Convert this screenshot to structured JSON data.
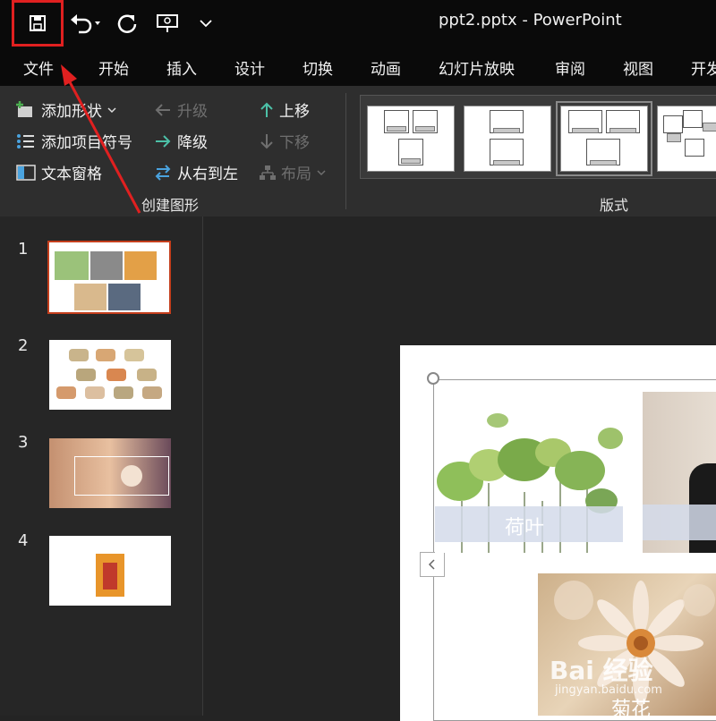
{
  "window": {
    "title": "ppt2.pptx  -  PowerPoint"
  },
  "quick_access": {
    "save": "save",
    "undo": "undo",
    "redo": "redo",
    "present": "present",
    "customize": "customize"
  },
  "tabs": [
    "文件",
    "开始",
    "插入",
    "设计",
    "切换",
    "动画",
    "幻灯片放映",
    "审阅",
    "视图",
    "开发"
  ],
  "ribbon": {
    "add_shape": "添加形状",
    "add_bullet": "添加项目符号",
    "text_pane": "文本窗格",
    "promote": "升级",
    "demote": "降级",
    "rtl": "从右到左",
    "move_up": "上移",
    "move_down": "下移",
    "layout": "布局",
    "group_create": "创建图形",
    "group_layouts": "版式"
  },
  "slides": [
    {
      "number": "1"
    },
    {
      "number": "2"
    },
    {
      "number": "3"
    },
    {
      "number": "4"
    }
  ],
  "slide_content": {
    "caption_lotus": "荷叶",
    "caption_daisy": "菊花"
  },
  "watermark": {
    "brand": "Bai 经验",
    "url": "jingyan.baidu.com"
  },
  "colors": {
    "accent": "#c43e1c",
    "highlight_box": "#e02020",
    "arrow": "#e02020"
  }
}
